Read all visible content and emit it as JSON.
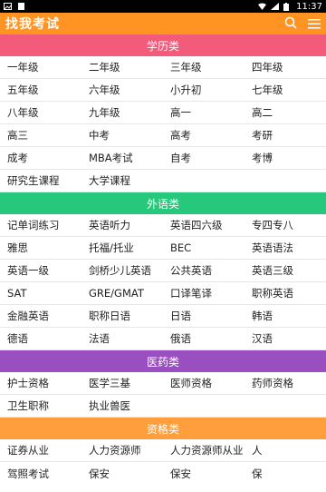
{
  "status_bar": {
    "time": "11:37"
  },
  "app": {
    "title": "找我考试"
  },
  "colors": {
    "app_bar": "#ff9423",
    "section_1": "#f25c7a",
    "section_2": "#26c97b",
    "section_3": "#9a4fc0",
    "section_4": "#ff9e3d"
  },
  "sections": [
    {
      "title": "学历类",
      "rows": [
        [
          "一年级",
          "二年级",
          "三年级",
          "四年级"
        ],
        [
          "五年级",
          "六年级",
          "小升初",
          "七年级"
        ],
        [
          "八年级",
          "九年级",
          "高一",
          "高二"
        ],
        [
          "高三",
          "中考",
          "高考",
          "考研"
        ],
        [
          "成考",
          "MBA考试",
          "自考",
          "考博"
        ],
        [
          "研究生课程",
          "大学课程",
          "",
          ""
        ]
      ]
    },
    {
      "title": "外语类",
      "rows": [
        [
          "记单词练习",
          "英语听力",
          "英语四六级",
          "专四专八"
        ],
        [
          "雅思",
          "托福/托业",
          "BEC",
          "英语语法"
        ],
        [
          "英语一级",
          "剑桥少儿英语",
          "公共英语",
          "英语三级"
        ],
        [
          "SAT",
          "GRE/GMAT",
          "口译笔译",
          "职称英语"
        ],
        [
          "金融英语",
          "职称日语",
          "日语",
          "韩语"
        ],
        [
          "德语",
          "法语",
          "俄语",
          "汉语"
        ]
      ]
    },
    {
      "title": "医药类",
      "rows": [
        [
          "护士资格",
          "医学三基",
          "医师资格",
          "药师资格"
        ],
        [
          "卫生职称",
          "执业兽医",
          "",
          ""
        ]
      ]
    },
    {
      "title": "资格类",
      "rows": [
        [
          "证券从业",
          "人力资源师",
          "人力资源师从业",
          "人"
        ],
        [
          "驾照考试",
          "保安",
          "保安",
          "保"
        ]
      ]
    }
  ]
}
